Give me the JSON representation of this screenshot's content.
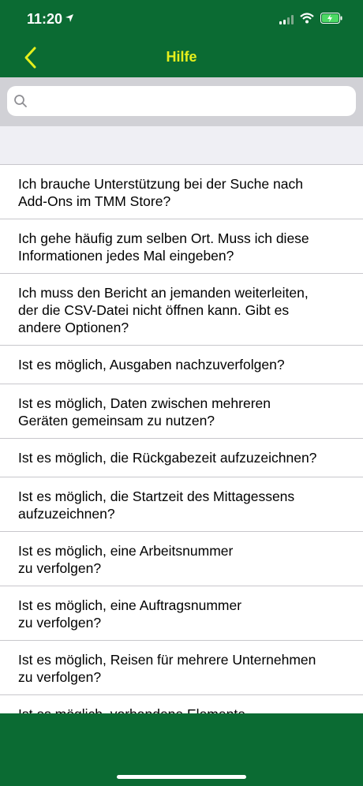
{
  "status_bar": {
    "time": "11:20"
  },
  "nav": {
    "title": "Hilfe"
  },
  "search": {
    "placeholder": "",
    "value": ""
  },
  "colors": {
    "bar_green": "#0b6b33",
    "title_yellow": "#e6ef1c",
    "separator": "#c8c7cc"
  },
  "icons": [
    "location-arrow-icon",
    "signal-icon",
    "wifi-icon",
    "battery-charging-icon",
    "back-chevron-icon",
    "search-icon"
  ],
  "faq": [
    "Ich brauche Unterstützung bei der Suche nach\nAdd-Ons im TMM Store?",
    "Ich gehe häufig zum selben Ort. Muss ich diese\nInformationen jedes Mal eingeben?",
    "Ich muss den Bericht an jemanden weiterleiten,\nder die CSV-Datei nicht öffnen kann. Gibt es\nandere Optionen?",
    "Ist es möglich, Ausgaben nachzuverfolgen?",
    "Ist es möglich, Daten zwischen mehreren\nGeräten gemeinsam zu nutzen?",
    "Ist es möglich, die Rückgabezeit aufzuzeichnen?",
    "Ist es möglich, die Startzeit des Mittagessens\naufzuzeichnen?",
    "Ist es möglich, eine Arbeitsnummer\nzu verfolgen?",
    "Ist es möglich, eine Auftragsnummer\nzu verfolgen?",
    "Ist es möglich, Reisen für mehrere Unternehmen\nzu verfolgen?",
    "Ist es möglich, vorhandene Elemente"
  ]
}
